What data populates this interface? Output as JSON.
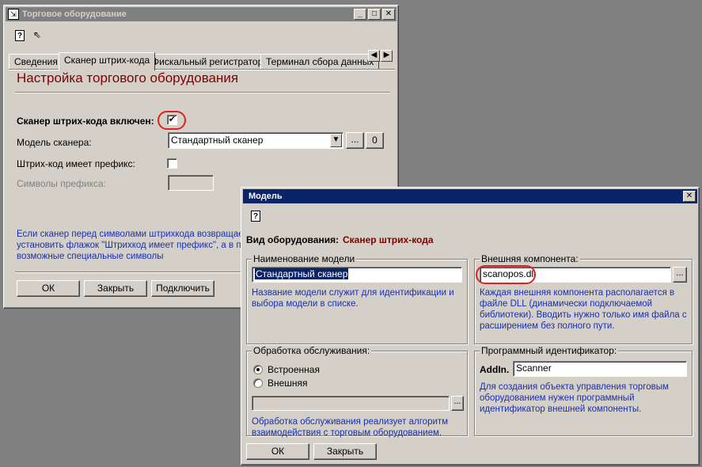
{
  "main_window": {
    "title": "Торговое оборудование",
    "tabs": [
      "Сведения",
      "Сканер штрих-кода",
      "Фискальный регистратор",
      "Терминал сбора данных"
    ],
    "heading": "Настройка торгового оборудования",
    "scanner_enabled_label": "Сканер штрих-кода включен:",
    "scanner_enabled_mark": "✔",
    "model_label": "Модель сканера:",
    "model_value": "Стандартный сканер",
    "ellipsis": "...",
    "clear": "0",
    "prefix_label": "Штрих-код имеет префикс:",
    "prefix_symbols_label": "Символы префикса:",
    "info_line1": "Если сканер перед символами штрихкода возвращает",
    "info_line2": "установить флажок \"Штрихкод имеет префикс\", а в пол",
    "info_line3": "возможные специальные символы",
    "ok": "ОК",
    "close": "Закрыть",
    "connect": "Подключить"
  },
  "model_dialog": {
    "title": "Модель",
    "close_glyph": "✕",
    "equipment_type_label": "Вид оборудования:",
    "equipment_type_value": "Сканер штрих-кода",
    "model_name_group": "Наименование модели",
    "model_name_value": "Стандартный сканер",
    "model_name_hint1": "Название модели служит для идентификации и",
    "model_name_hint2": "выбора модели в списке.",
    "ext_component_group": "Внешняя компонента:",
    "ext_component_value": "scanopos.dll",
    "ext_hint1": "Каждая внешняя компонента располагается в",
    "ext_hint2": "файле DLL (динамически подключаемой",
    "ext_hint3": "библиотеки). Вводить нужно только имя файла с",
    "ext_hint4": "расширением без полного пути.",
    "service_group": "Обработка обслуживания:",
    "radio_builtin": "Встроенная",
    "radio_external": "Внешняя",
    "service_hint1": "Обработка обслуживания реализует алгоритм",
    "service_hint2": "взаимодействия с торговым оборудованием.",
    "progid_group": "Программный идентификатор:",
    "addin_label": "AddIn.",
    "addin_value": "Scanner",
    "progid_hint1": "Для создания объекта управления торговым",
    "progid_hint2": "оборудованием нужен программный",
    "progid_hint3": "идентификатор внешней компоненты.",
    "ok": "ОК",
    "close": "Закрыть"
  },
  "colors": {
    "heading": "#800000",
    "hint_text": "#1a2fb0",
    "highlight_ellipse": "#e02020",
    "active_title": "#0a246a"
  }
}
